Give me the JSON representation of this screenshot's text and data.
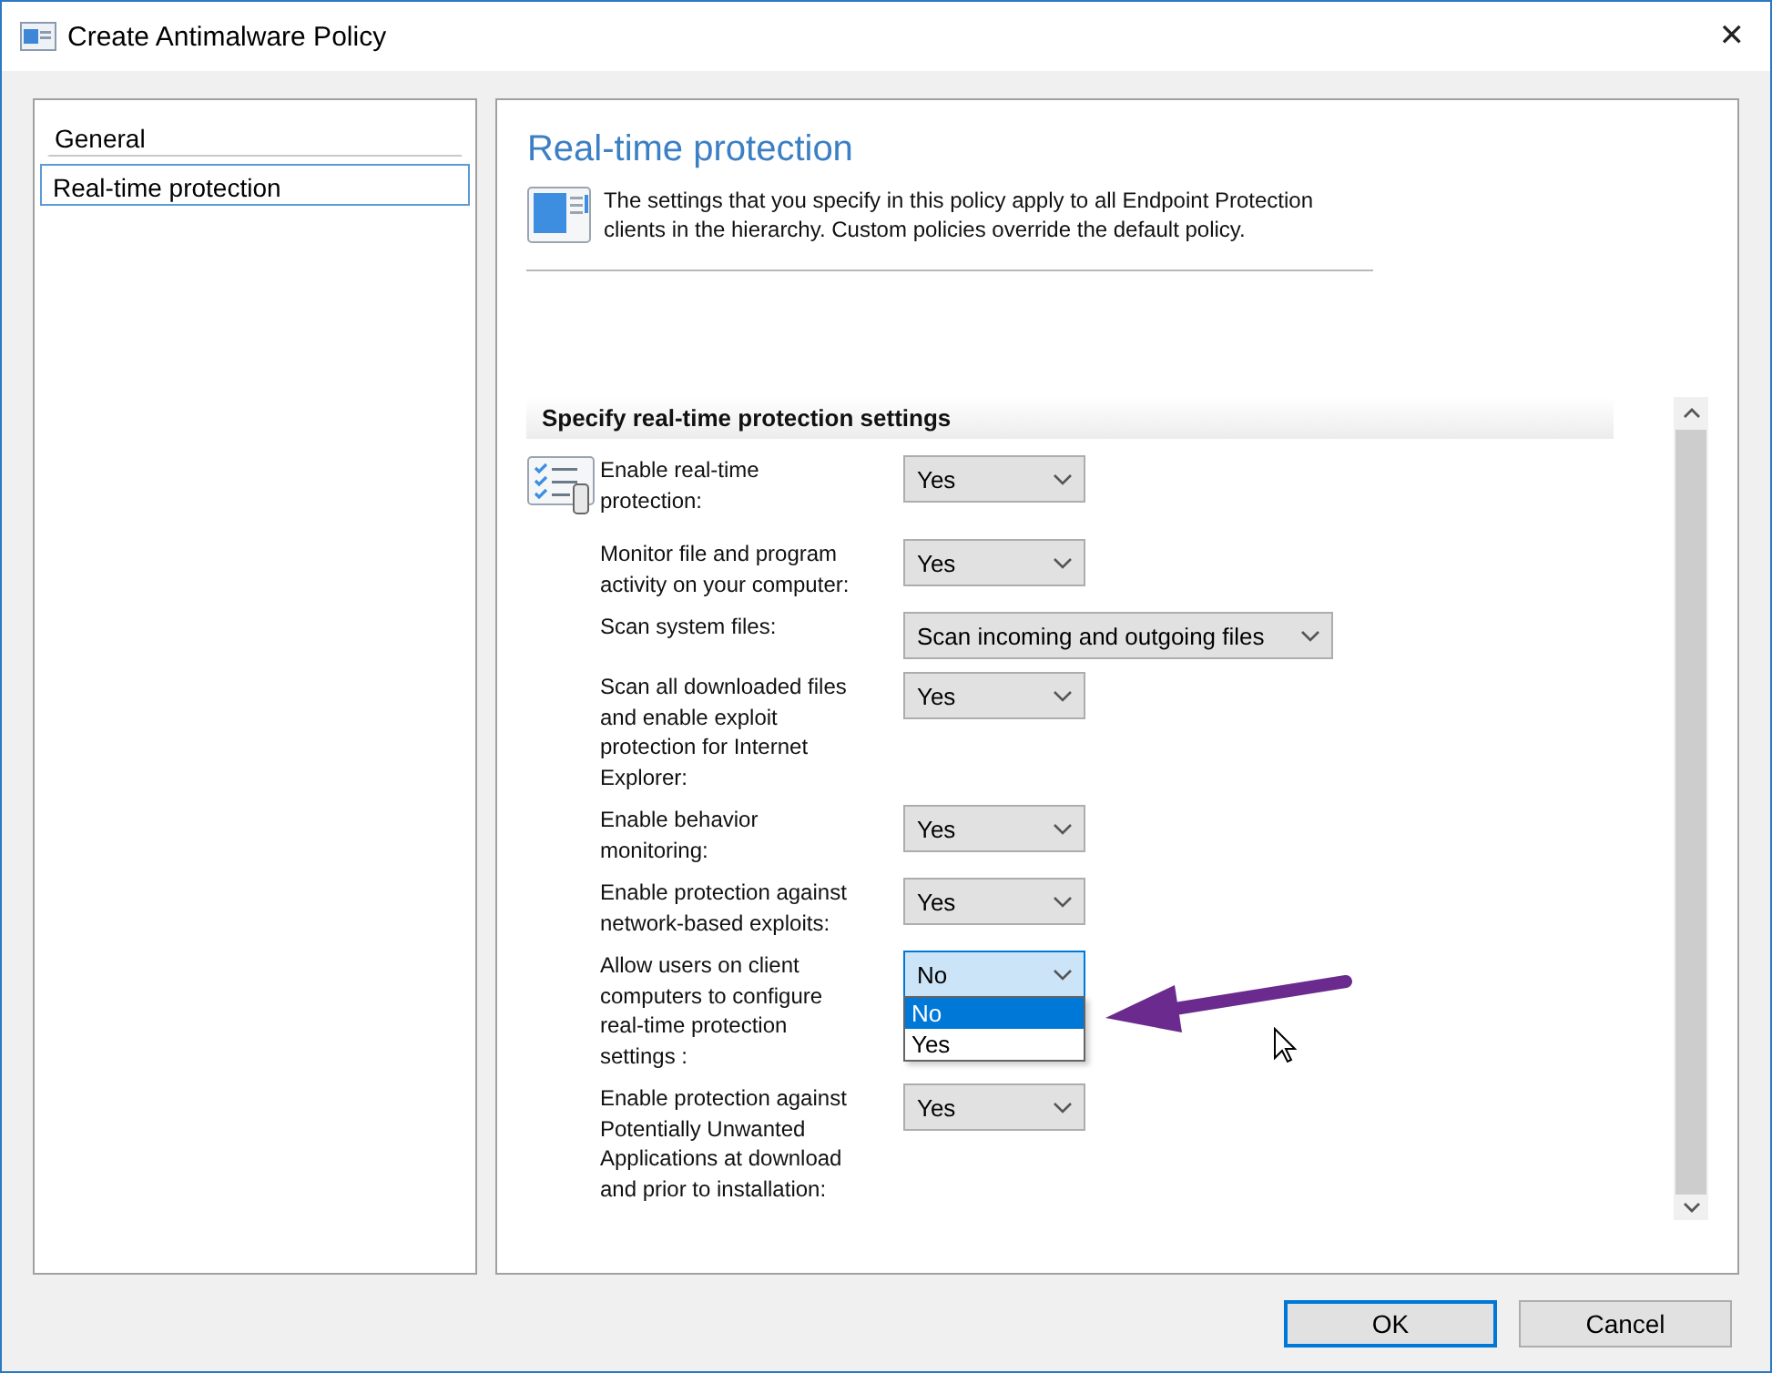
{
  "window": {
    "title": "Create Antimalware Policy",
    "close": "✕"
  },
  "sidebar": {
    "items": [
      {
        "label": "General",
        "selected": false
      },
      {
        "label": "Real-time protection",
        "selected": true
      }
    ]
  },
  "page": {
    "heading": "Real-time protection",
    "description": "The settings that you specify in this policy apply to all Endpoint Protection clients in the hierarchy. Custom policies override the default policy."
  },
  "section": {
    "title": "Specify real-time protection settings"
  },
  "settings": [
    {
      "label": "Enable real-time protection:",
      "value": "Yes",
      "focused": false
    },
    {
      "label": "Monitor file and program activity on your computer:",
      "value": "Yes",
      "focused": false
    },
    {
      "label": "Scan system files:",
      "value": "Scan incoming and outgoing files",
      "focused": false
    },
    {
      "label": "Scan all downloaded files and enable exploit protection for Internet Explorer:",
      "value": "Yes",
      "focused": false
    },
    {
      "label": "Enable behavior monitoring:",
      "value": "Yes",
      "focused": false
    },
    {
      "label": "Enable protection against network-based exploits:",
      "value": "Yes",
      "focused": false
    },
    {
      "label": "Allow users on client computers to configure real-time protection settings :",
      "value": "No",
      "focused": true,
      "options": [
        {
          "label": "No",
          "selected": true
        },
        {
          "label": "Yes",
          "selected": false
        }
      ]
    },
    {
      "label": "Enable protection against Potentially Unwanted Applications at download and prior to installation:",
      "value": "Yes",
      "focused": false
    }
  ],
  "buttons": [
    {
      "label": "OK",
      "default": true
    },
    {
      "label": "Cancel",
      "default": false
    }
  ]
}
